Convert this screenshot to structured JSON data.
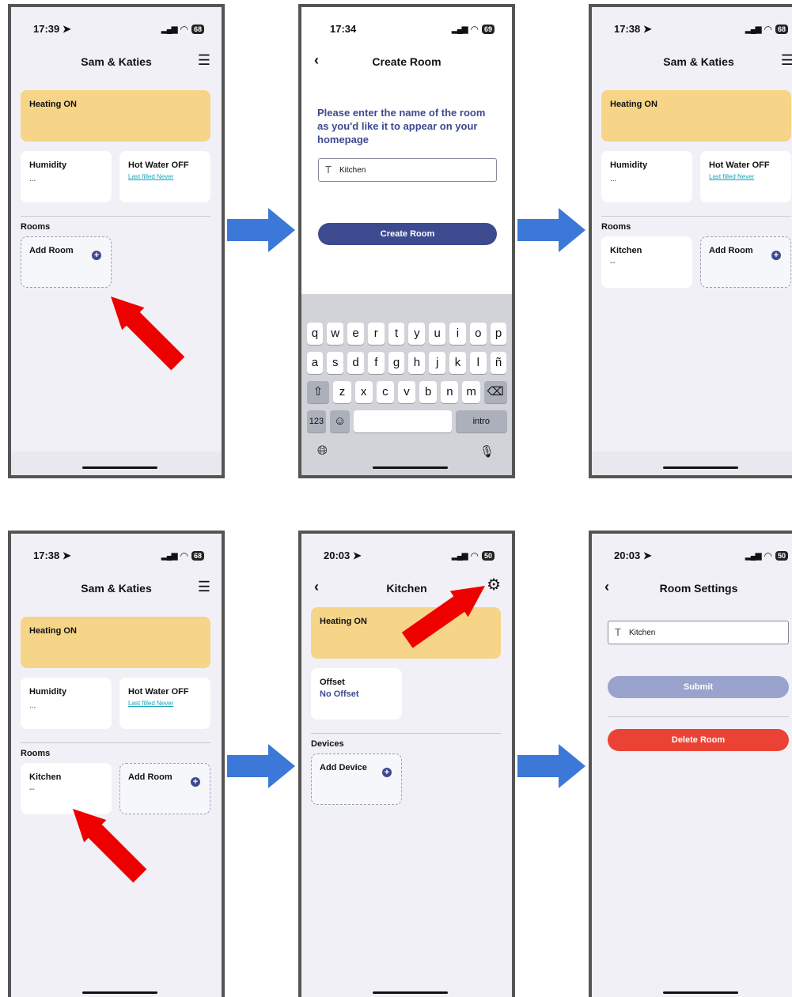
{
  "screens": {
    "home1": {
      "time": "17:39",
      "battery": "68",
      "title": "Sam & Katies",
      "heating": "Heating ON",
      "humidity_title": "Humidity",
      "humidity_value": "...",
      "hot_water_title": "Hot Water OFF",
      "hot_water_link": "Last filled Never",
      "rooms_label": "Rooms",
      "add_room": "Add Room"
    },
    "create_room": {
      "time": "17:34",
      "battery": "69",
      "title": "Create Room",
      "prompt": "Please enter the name of the room as you'd like it to appear on your homepage",
      "input_value": "Kitchen",
      "button": "Create Room",
      "keyboard": {
        "row1": [
          "q",
          "w",
          "e",
          "r",
          "t",
          "y",
          "u",
          "i",
          "o",
          "p"
        ],
        "row2": [
          "a",
          "s",
          "d",
          "f",
          "g",
          "h",
          "j",
          "k",
          "l",
          "ñ"
        ],
        "row3": [
          "z",
          "x",
          "c",
          "v",
          "b",
          "n",
          "m"
        ],
        "numbers_key": "123",
        "return_key": "intro"
      }
    },
    "home2": {
      "time": "17:38",
      "battery": "68",
      "title": "Sam & Katies",
      "heating": "Heating ON",
      "humidity_title": "Humidity",
      "humidity_value": "...",
      "hot_water_title": "Hot Water OFF",
      "hot_water_link": "Last filled Never",
      "rooms_label": "Rooms",
      "room_name": "Kitchen",
      "room_value": "--",
      "add_room": "Add Room"
    },
    "home3": {
      "time": "17:38",
      "battery": "68",
      "title": "Sam & Katies",
      "heating": "Heating ON",
      "humidity_title": "Humidity",
      "humidity_value": "...",
      "hot_water_title": "Hot Water OFF",
      "hot_water_link": "Last filled Never",
      "rooms_label": "Rooms",
      "room_name": "Kitchen",
      "room_value": "--",
      "add_room": "Add Room"
    },
    "kitchen": {
      "time": "20:03",
      "battery": "50",
      "title": "Kitchen",
      "heating": "Heating ON",
      "offset_title": "Offset",
      "offset_value": "No Offset",
      "devices_label": "Devices",
      "add_device": "Add Device"
    },
    "room_settings": {
      "time": "20:03",
      "battery": "50",
      "title": "Room Settings",
      "input_value": "Kitchen",
      "submit": "Submit",
      "delete": "Delete Room"
    }
  },
  "colors": {
    "heating_card": "#f6d488",
    "brand_blue": "#3d4a8f",
    "submit_disabled": "#9aa3cc",
    "delete_red": "#ea4335",
    "flow_arrow": "#3c78d8",
    "tap_arrow": "#ee0000"
  }
}
